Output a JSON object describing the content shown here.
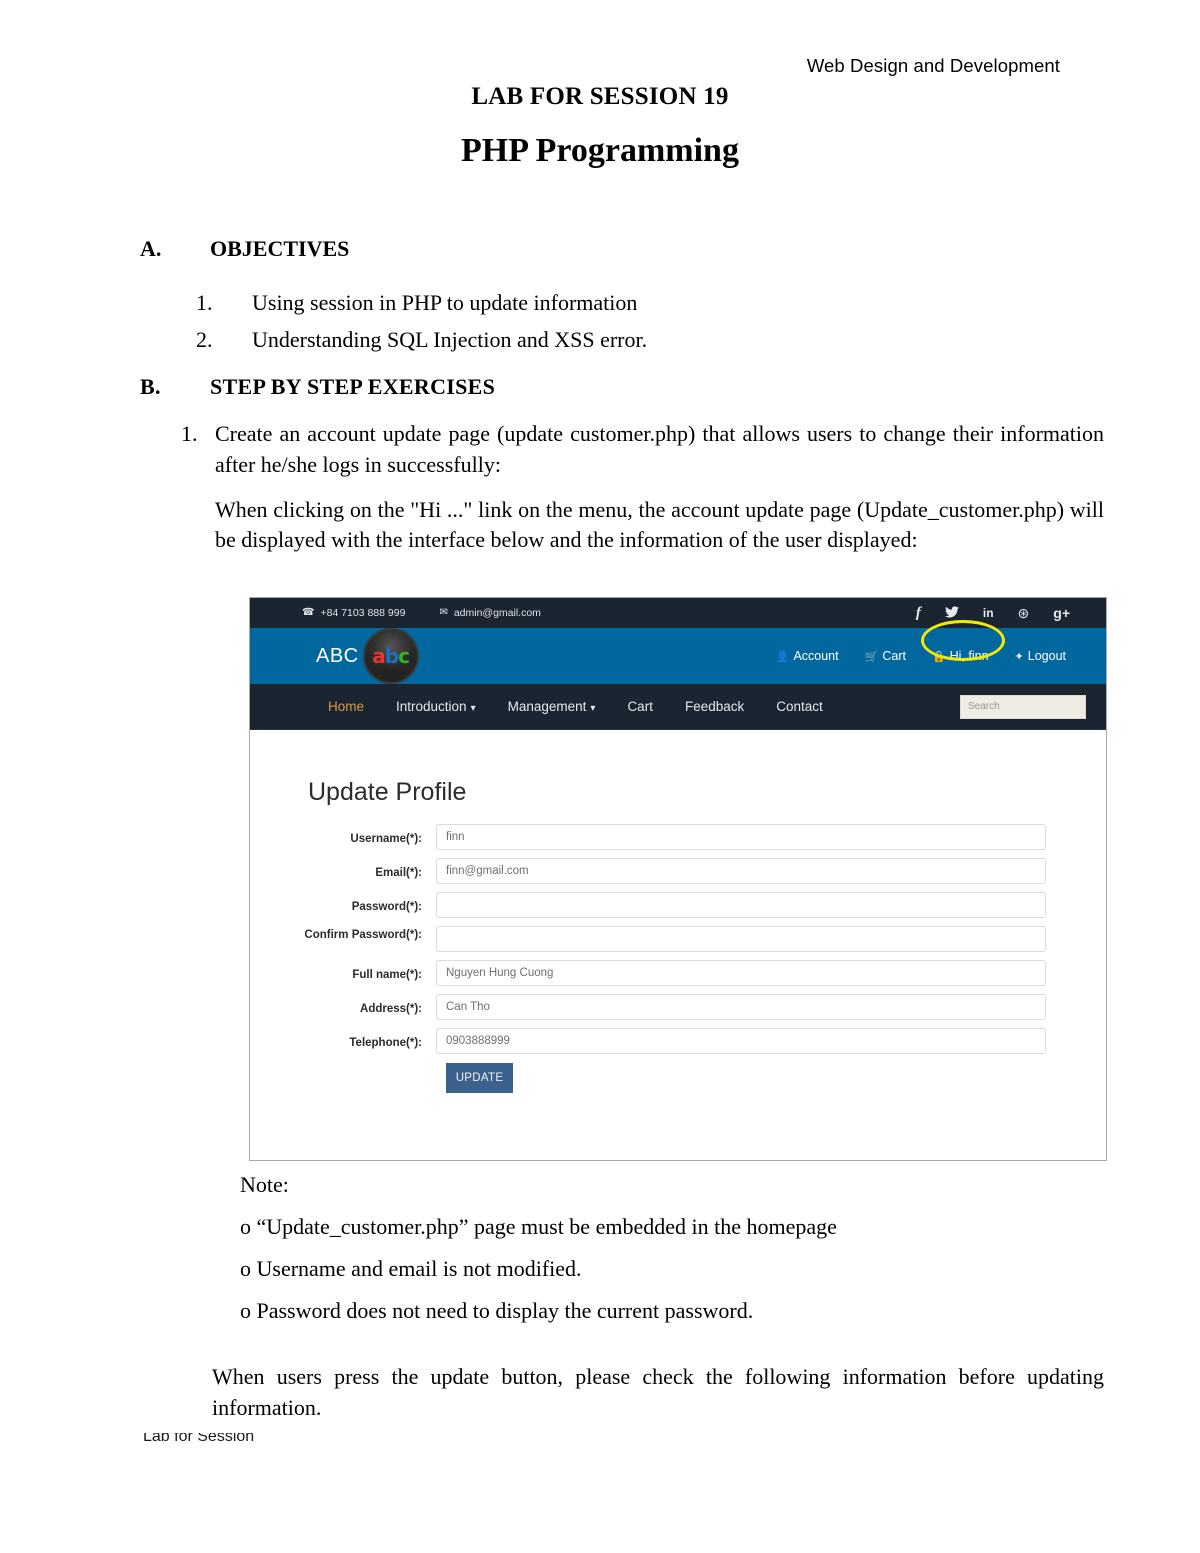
{
  "document": {
    "running_header": "Web Design and Development",
    "title_line1": "LAB FOR SESSION 19",
    "title_line2": "PHP Programming",
    "section_a": {
      "letter": "A.",
      "heading": "OBJECTIVES"
    },
    "objectives": [
      {
        "num": "1.",
        "text": "Using session in PHP to update information"
      },
      {
        "num": "2.",
        "text": "Understanding SQL Injection and XSS error."
      }
    ],
    "section_b": {
      "letter": "B.",
      "heading": "STEP BY STEP EXERCISES"
    },
    "exercise_1": {
      "num": "1.",
      "para1": "Create an account update page (update customer.php) that allows users to change their information after he/she logs in successfully:",
      "para2": "When clicking on the \"Hi ...\" link on the menu, the account update page (Update_customer.php) will be displayed with the interface below and the information of the user displayed:"
    },
    "note": {
      "heading": "Note:",
      "items": [
        "o “Update_customer.php” page must be embedded in the homepage",
        "o Username and email is not modified.",
        "o Password does not need to display the current password."
      ]
    },
    "closing_paragraph": "When users press the update button, please check the following information before updating information.",
    "footer": {
      "left": "Lab for Session",
      "right": ""
    }
  },
  "screenshot": {
    "topbar": {
      "phone_icon": "phone-icon",
      "phone": "+84 7103 888 999",
      "email_icon": "envelope-icon",
      "email": "admin@gmail.com",
      "social": [
        {
          "name": "facebook-icon",
          "glyph": "f"
        },
        {
          "name": "twitter-icon",
          "glyph": "ᴠ"
        },
        {
          "name": "linkedin-icon",
          "glyph": "in"
        },
        {
          "name": "dribbble-icon",
          "glyph": "⊛"
        },
        {
          "name": "google-plus-icon",
          "glyph": "g+"
        }
      ]
    },
    "brand": {
      "text": "ABC",
      "disc_a": "a",
      "disc_b": "b",
      "disc_c": "c"
    },
    "account_links": [
      {
        "name": "account-link",
        "icon": "user-icon",
        "glyph": "👤",
        "label": "Account"
      },
      {
        "name": "cart-link",
        "icon": "cart-icon",
        "glyph": "🛒",
        "label": "Cart"
      },
      {
        "name": "hi-user-link",
        "icon": "lock-icon",
        "glyph": "🔒",
        "label": "Hi, finn"
      },
      {
        "name": "logout-link",
        "icon": "power-icon",
        "glyph": "✦",
        "label": "Logout"
      }
    ],
    "nav_items": [
      {
        "label": "Home",
        "active": true,
        "caret": false
      },
      {
        "label": "Introduction",
        "active": false,
        "caret": true
      },
      {
        "label": "Management",
        "active": false,
        "caret": true
      },
      {
        "label": "Cart",
        "active": false,
        "caret": false
      },
      {
        "label": "Feedback",
        "active": false,
        "caret": false
      },
      {
        "label": "Contact",
        "active": false,
        "caret": false
      }
    ],
    "search_placeholder": "Search",
    "form": {
      "title": "Update Profile",
      "fields": [
        {
          "label": "Username(*):",
          "value": "finn",
          "two_line": false
        },
        {
          "label": "Email(*):",
          "value": "finn@gmail.com",
          "two_line": false
        },
        {
          "label": "Password(*):",
          "value": "",
          "two_line": false
        },
        {
          "label": "Confirm Password(*):",
          "value": "",
          "two_line": true
        },
        {
          "label": "Full name(*):",
          "value": "Nguyen Hung Cuong",
          "two_line": false
        },
        {
          "label": "Address(*):",
          "value": "Can Tho",
          "two_line": false
        },
        {
          "label": "Telephone(*):",
          "value": "0903888999",
          "two_line": false
        }
      ],
      "submit_label": "UPDATE"
    },
    "colors": {
      "topbar_bg": "#1b2431",
      "midbar_bg": "#00679f",
      "navbar_bg": "#1b2431",
      "nav_active": "#d99b3f",
      "button_bg": "#3a628c",
      "highlight_circle": "#f2ea00"
    }
  }
}
